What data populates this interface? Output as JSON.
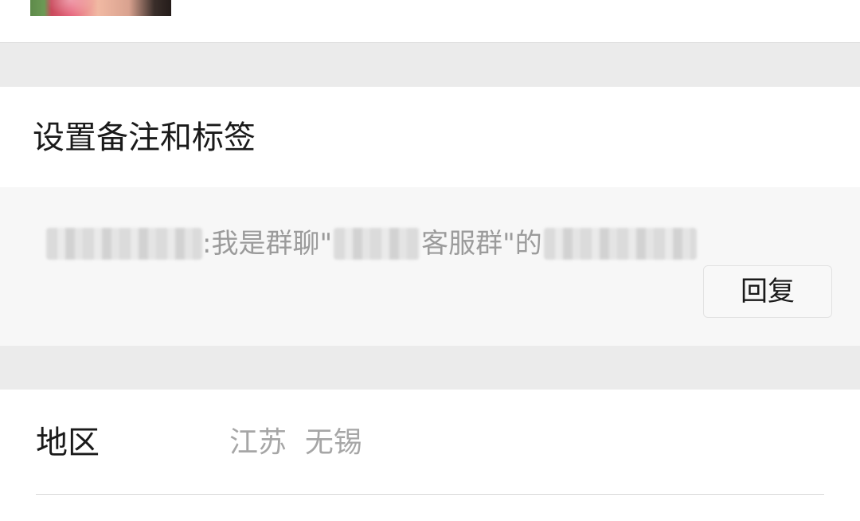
{
  "header": {
    "avatar_icon": "contact-avatar-photo"
  },
  "remark": {
    "label": "设置备注和标签"
  },
  "message": {
    "sep": ": ",
    "text_a": "我是群聊\"",
    "text_b": "客服群\"的",
    "reply_label": "回复"
  },
  "region": {
    "label": "地区",
    "value": "江苏  无锡"
  },
  "colors": {
    "section_gap": "#ebebeb",
    "card_bg": "#f7f7f7",
    "primary_text": "#1a1a1a",
    "secondary_text": "#9b9b9b"
  }
}
